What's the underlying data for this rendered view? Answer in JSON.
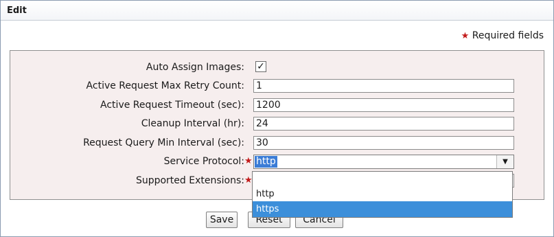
{
  "dialog": {
    "title": "Edit",
    "required_note": "Required fields"
  },
  "form": {
    "fields": [
      {
        "label": "Auto Assign Images:",
        "type": "checkbox",
        "checked": true,
        "check_glyph": "✓"
      },
      {
        "label": "Active Request Max Retry Count:",
        "type": "text",
        "value": "1"
      },
      {
        "label": "Active Request Timeout (sec):",
        "type": "text",
        "value": "1200"
      },
      {
        "label": "Cleanup Interval (hr):",
        "type": "text",
        "value": "24"
      },
      {
        "label": "Request Query Min Interval (sec):",
        "type": "text",
        "value": "30"
      },
      {
        "label": "Service Protocol:",
        "type": "select",
        "required": true,
        "value": "http"
      },
      {
        "label": "Supported Extensions:",
        "type": "text",
        "required": true,
        "value": ""
      }
    ],
    "dropdown": {
      "options": [
        "",
        "http",
        "https"
      ],
      "highlighted": "https"
    }
  },
  "buttons": {
    "save": "Save",
    "reset": "Reset",
    "cancel": "Cancel"
  },
  "glyphs": {
    "star": "★",
    "dropdown_arrow": "▼"
  },
  "colors": {
    "highlight": "#3c8fda",
    "required_star": "#c21a1a",
    "panel_bg": "#f6eeee"
  }
}
